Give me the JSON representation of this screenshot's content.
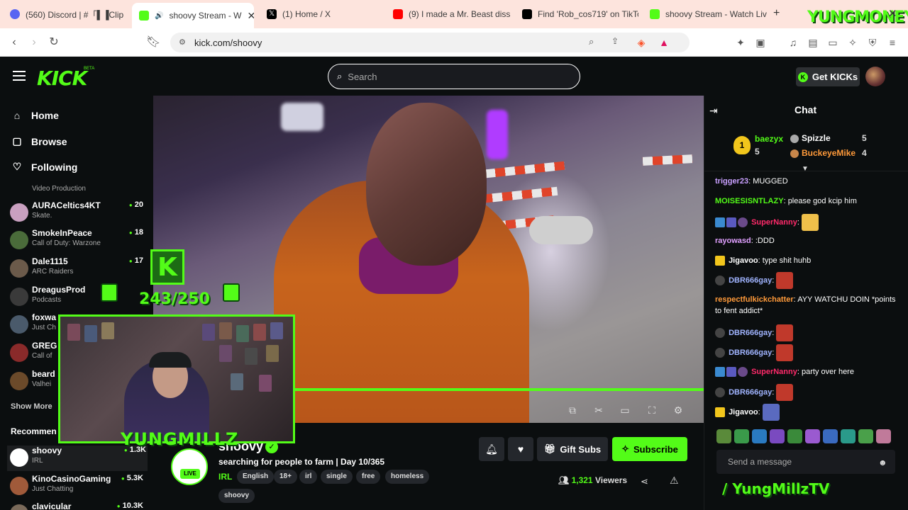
{
  "browser": {
    "tabs": [
      {
        "label": "(560) Discord | #「▌▐Clip",
        "color": "#5865f2"
      },
      {
        "label": "shoovy Stream - W",
        "color": "#53fc18"
      },
      {
        "label": "(1) Home / X",
        "color": "#000000"
      },
      {
        "label": "(9) I made a Mr. Beast diss",
        "color": "#ff0000"
      },
      {
        "label": "Find 'Rob_cos719' on TikTo",
        "color": "#000000"
      },
      {
        "label": "shoovy Stream - Watch Liv",
        "color": "#53fc18"
      }
    ],
    "url": "kick.com/shoovy",
    "overlay_brand": "YUNGMONEY"
  },
  "header": {
    "logo": "KICK",
    "beta": "BETA",
    "search_placeholder": "Search",
    "get_kicks": "Get KICKs"
  },
  "sidebar": {
    "nav": [
      {
        "label": "Home",
        "icon": "home-icon"
      },
      {
        "label": "Browse",
        "icon": "browse-icon"
      },
      {
        "label": "Following",
        "icon": "heart-icon"
      }
    ],
    "partial_category": "Video Production",
    "following": [
      {
        "name": "AURACeltics4KT",
        "category": "Skate.",
        "viewers": "20",
        "color": "#c9a0c0"
      },
      {
        "name": "SmokeInPeace",
        "category": "Call of Duty: Warzone",
        "viewers": "18",
        "color": "#4a6b3a"
      },
      {
        "name": "Dale1115",
        "category": "ARC Raiders",
        "viewers": "17",
        "color": "#6b5a4a"
      },
      {
        "name": "DreagusProd",
        "category": "Podcasts",
        "viewers": "",
        "color": "#3a3a3a"
      },
      {
        "name": "foxwa",
        "category": "Just Ch",
        "viewers": "",
        "color": "#4a5a6b"
      },
      {
        "name": "GREG",
        "category": "Call of",
        "viewers": "",
        "color": "#8a2a2a"
      },
      {
        "name": "beard",
        "category": "Valhei",
        "viewers": "",
        "color": "#6b4a2a"
      }
    ],
    "show_more": "Show More",
    "recommended_label": "Recommen",
    "recommended": [
      {
        "name": "shoovy",
        "category": "IRL",
        "viewers": "1.3K",
        "color": "#ffffff"
      },
      {
        "name": "KinoCasinoGaming",
        "category": "Just Chatting",
        "viewers": "5.3K",
        "color": "#a05a3a"
      },
      {
        "name": "clavicular",
        "category": "",
        "viewers": "10.3K",
        "color": "#7a6a5a"
      }
    ]
  },
  "overlay": {
    "sub_goal": "243/250",
    "kick_k": "K",
    "watermark": "YUNGMILLZ",
    "socials": "/ YungMillzTV"
  },
  "stream": {
    "streamer": "shoovy",
    "live": "LIVE",
    "title": "searching for people to farm | Day 10/365",
    "category": "IRL",
    "tags": [
      "English",
      "18+",
      "irl",
      "single",
      "free",
      "homeless",
      "shoovy"
    ],
    "gift_subs": "Gift Subs",
    "subscribe": "Subscribe",
    "viewers": "1,321",
    "viewers_label": "Viewers"
  },
  "chat": {
    "title": "Chat",
    "leaderboard": [
      {
        "name": "baezyx",
        "count": "5",
        "rank": "1"
      },
      {
        "name": "Spizzle",
        "count": "5"
      },
      {
        "name": "BuckeyeMike",
        "count": "4"
      }
    ],
    "messages": [
      {
        "user": "trigger23",
        "text": "MUGGED",
        "color": "#c9a0ff"
      },
      {
        "user": "MOISESISNTLAZY",
        "text": "please god kcip him",
        "color": "#53fc18"
      },
      {
        "user": "SuperNanny",
        "text": "",
        "color": "#ff2a6a"
      },
      {
        "user": "rayowasd",
        "text": ":DDD",
        "color": "#e0a0ff"
      },
      {
        "user": "Jigavoo",
        "text": "type shit huhb",
        "color": "#ffffff"
      },
      {
        "user": "DBR666gay",
        "text": "",
        "color": "#a0b4ff"
      },
      {
        "user": "respectfulkickchatter",
        "text": "AYY WATCHU DOIN *points to fent addict*",
        "color": "#ff9a3a"
      },
      {
        "user": "DBR666gay",
        "text": "",
        "color": "#a0b4ff"
      },
      {
        "user": "DBR666gay",
        "text": "",
        "color": "#a0b4ff"
      },
      {
        "user": "SuperNanny",
        "text": "party over here",
        "color": "#ff2a6a"
      },
      {
        "user": "DBR666gay",
        "text": "",
        "color": "#a0b4ff"
      },
      {
        "user": "Jigavoo",
        "text": "",
        "color": "#ffffff"
      }
    ],
    "input_placeholder": "Send a message"
  }
}
